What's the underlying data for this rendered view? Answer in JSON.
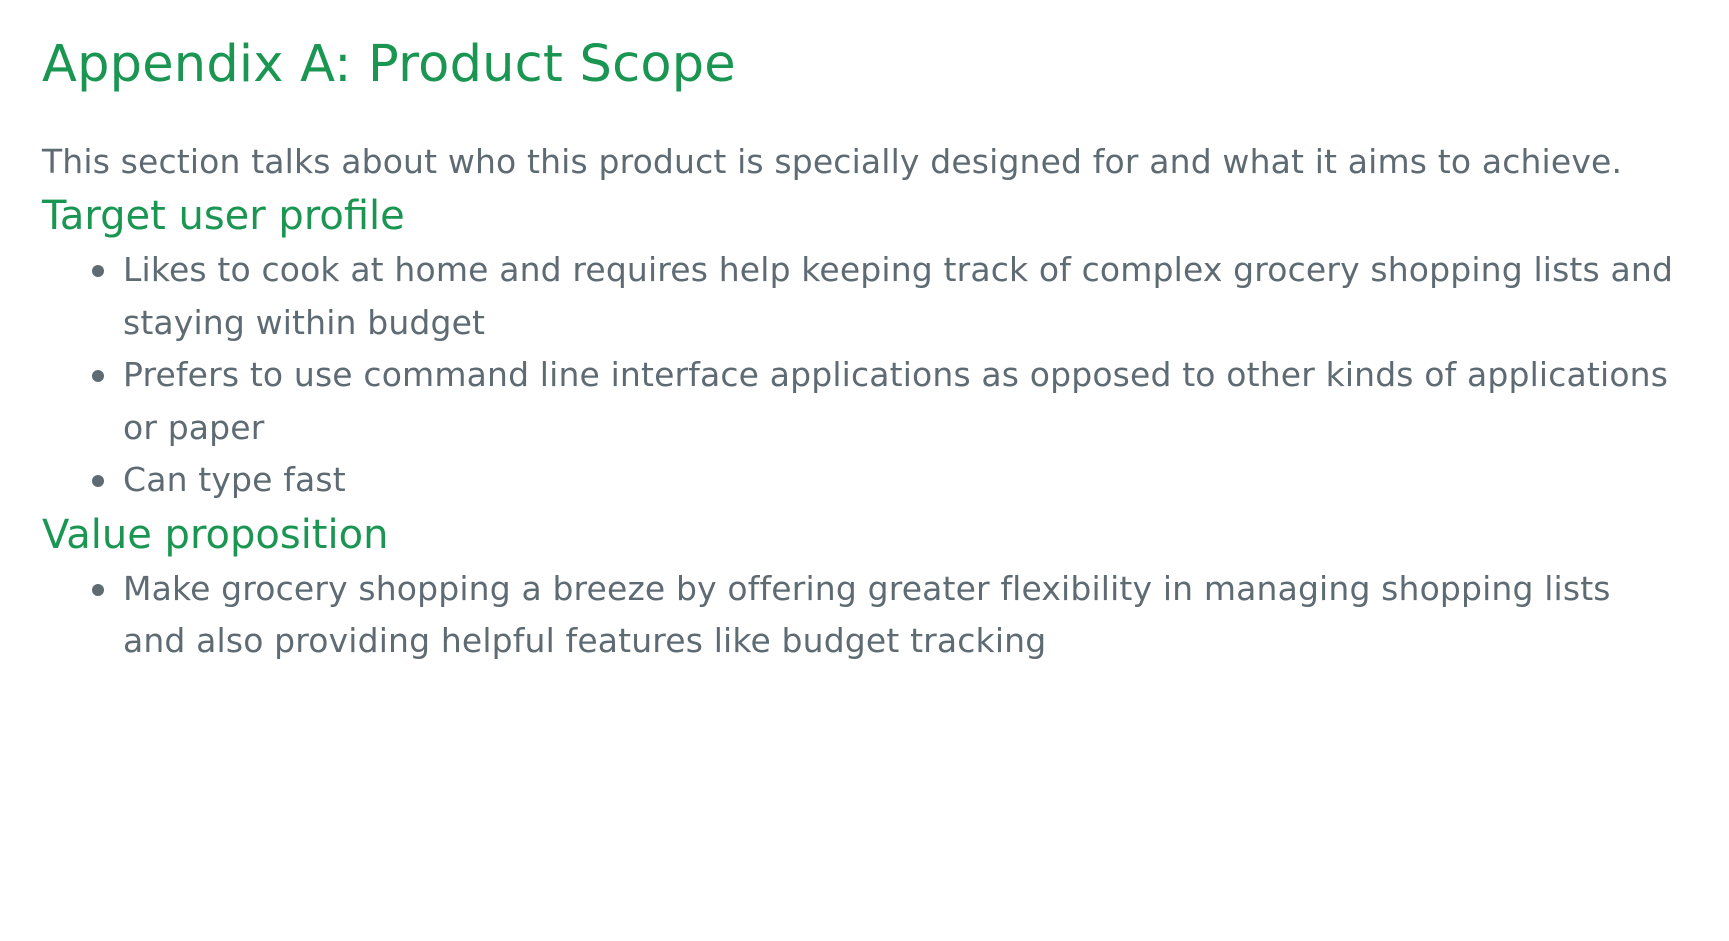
{
  "title": "Appendix A: Product Scope",
  "intro": "This section talks about who this product is specially designed for and what it aims to achieve.",
  "sections": [
    {
      "heading": "Target user profile",
      "items": [
        "Likes to cook at home and requires help keeping track of complex grocery shopping lists and staying within budget",
        "Prefers to use command line interface applications as opposed to other kinds of applications or paper",
        "Can type fast"
      ]
    },
    {
      "heading": "Value proposition",
      "items": [
        "Make grocery shopping a breeze by offering greater flexibility in managing shopping lists and also providing helpful features like budget tracking"
      ]
    }
  ],
  "colors": {
    "heading": "#1a9652",
    "body_text": "#5f6b73",
    "background": "#ffffff"
  },
  "icons": {
    "bullet": "bullet-dot-icon"
  }
}
